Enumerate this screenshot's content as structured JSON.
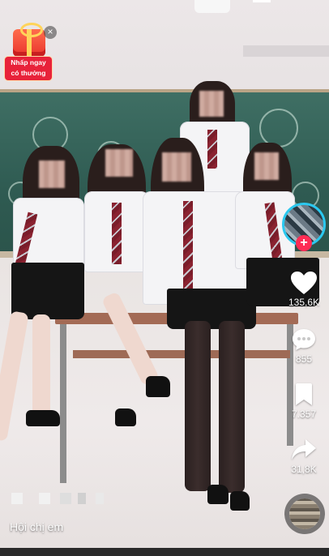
{
  "promo": {
    "line1": "Nhấp ngay",
    "line2": "có thưởng",
    "close_symbol": "×"
  },
  "actions": {
    "likes": "135,6K",
    "comments": "855",
    "saves": "7.357",
    "shares": "31,8K"
  },
  "follow_symbol": "+",
  "caption": "Hội chị em",
  "icons": {
    "like": "heart-icon",
    "comment": "comment-bubble-icon",
    "save": "bookmark-icon",
    "share": "share-arrow-icon",
    "close": "close-icon",
    "music": "music-disc-icon"
  },
  "colors": {
    "follow": "#fe2c55",
    "avatar_ring": "#2bc8ef",
    "promo": "#e8223a"
  }
}
